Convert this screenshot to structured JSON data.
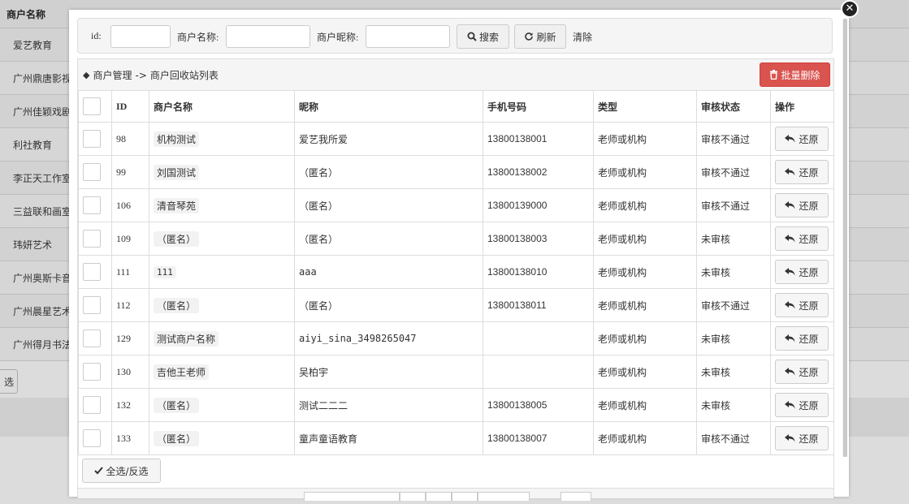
{
  "background": {
    "header_label": "商户名称",
    "rows": [
      "爱艺教育",
      "广州鼎唐影视",
      "广州佳颖戏剧",
      "利社教育",
      "李正天工作室",
      "三益联和画室",
      "玮妍艺术",
      "广州奥斯卡音乐",
      "广州晨星艺术",
      "广州得月书法"
    ],
    "partial_button": "选"
  },
  "modal": {
    "close_glyph": "✕"
  },
  "search": {
    "id_label": "id:",
    "id_value": "",
    "name_label": "商户名称:",
    "name_value": "",
    "nickname_label": "商户昵称:",
    "nickname_value": "",
    "search_button": "搜索",
    "refresh_button": "刷新",
    "clear_link": "清除"
  },
  "breadcrumb": {
    "part1": "商户管理",
    "separator": "->",
    "part2": "商户回收站列表"
  },
  "batch_delete": "批量删除",
  "table": {
    "headers": [
      "ID",
      "商户名称",
      "昵称",
      "手机号码",
      "类型",
      "审核状态",
      "操作"
    ],
    "rows": [
      {
        "id": "98",
        "name": "机构测试",
        "nickname": "爱艺我所爱",
        "phone": "13800138001",
        "type": "老师或机构",
        "status": "审核不通过",
        "action": "还原"
      },
      {
        "id": "99",
        "name": "刘国测试",
        "nickname": "（匿名）",
        "phone": "13800138002",
        "type": "老师或机构",
        "status": "审核不通过",
        "action": "还原"
      },
      {
        "id": "106",
        "name": "清音琴苑",
        "nickname": "（匿名）",
        "phone": "13800139000",
        "type": "老师或机构",
        "status": "审核不通过",
        "action": "还原"
      },
      {
        "id": "109",
        "name": "（匿名）",
        "nickname": "（匿名）",
        "phone": "13800138003",
        "type": "老师或机构",
        "status": "未审核",
        "action": "还原"
      },
      {
        "id": "111",
        "name": "111",
        "nickname": "aaa",
        "phone": "13800138010",
        "type": "老师或机构",
        "status": "未审核",
        "action": "还原"
      },
      {
        "id": "112",
        "name": "（匿名）",
        "nickname": "（匿名）",
        "phone": "13800138011",
        "type": "老师或机构",
        "status": "审核不通过",
        "action": "还原"
      },
      {
        "id": "129",
        "name": "测试商户名称",
        "nickname": "aiyi_sina_3498265047",
        "phone": "",
        "type": "老师或机构",
        "status": "未审核",
        "action": "还原"
      },
      {
        "id": "130",
        "name": "吉他王老师",
        "nickname": "吴柏宇",
        "phone": "",
        "type": "老师或机构",
        "status": "未审核",
        "action": "还原"
      },
      {
        "id": "132",
        "name": "（匿名）",
        "nickname": "测试二二二",
        "phone": "13800138005",
        "type": "老师或机构",
        "status": "未审核",
        "action": "还原"
      },
      {
        "id": "133",
        "name": "（匿名）",
        "nickname": "童声童语教育",
        "phone": "13800138007",
        "type": "老师或机构",
        "status": "审核不通过",
        "action": "还原"
      }
    ]
  },
  "footer": {
    "select_all": "全选/反选"
  },
  "colors": {
    "danger": "#d9534f",
    "overlay_bg": "#dcdcdc"
  }
}
